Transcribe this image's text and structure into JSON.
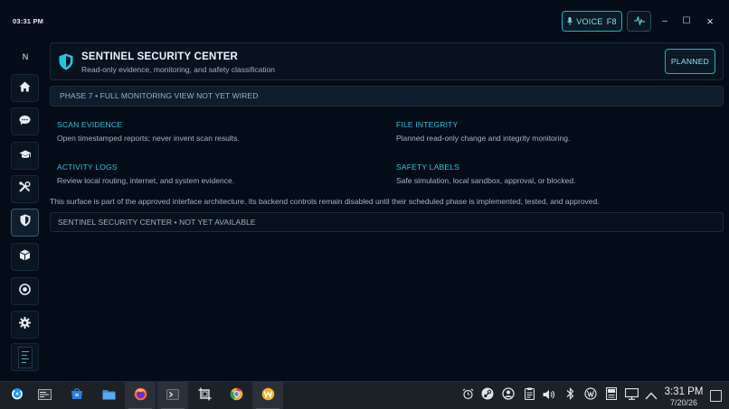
{
  "topbar": {
    "time": "03:31 PM",
    "voice_label": "VOICE",
    "voice_key": "F8",
    "minimize": "–",
    "maximize": "☐",
    "close": "×"
  },
  "rail": {
    "letter": "N",
    "items": [
      "home-icon",
      "chat-icon",
      "graduation-cap-icon",
      "tools-icon",
      "shield-icon",
      "box-icon",
      "target-icon",
      "gear-icon"
    ],
    "active": "shield-icon"
  },
  "header": {
    "title": "SENTINEL SECURITY CENTER",
    "subtitle": "Read-only evidence, monitoring, and safety classification",
    "badge": "PLANNED"
  },
  "phase": "PHASE 7 • FULL MONITORING VIEW NOT YET WIRED",
  "sections": [
    {
      "title": "SCAN EVIDENCE",
      "desc": "Open timestamped reports; never invent scan results."
    },
    {
      "title": "FILE INTEGRITY",
      "desc": "Planned read-only change and integrity monitoring."
    },
    {
      "title": "ACTIVITY LOGS",
      "desc": "Review local routing, internet, and system evidence."
    },
    {
      "title": "SAFETY LABELS",
      "desc": "Safe simulation, local sandbox, approval, or blocked."
    }
  ],
  "note": "This surface is part of the approved interface architecture. Its backend controls remain disabled until their scheduled phase is implemented, tested, and approved.",
  "status": "SENTINEL SECURITY CENTER • NOT YET AVAILABLE",
  "taskbar": {
    "apps": [
      "app-launcher-icon",
      "task-manager-icon",
      "discover-store-icon",
      "file-manager-icon",
      "firefox-icon",
      "terminal-icon",
      "screenshot-icon",
      "chrome-like-icon",
      "w-app-icon"
    ],
    "tray": [
      "alarm-icon",
      "steam-icon",
      "steam-user-icon",
      "clipboard-icon",
      "volume-icon",
      "bluetooth-icon",
      "vpn-icon",
      "notes-icon",
      "display-icon",
      "chevron-up-icon"
    ],
    "time": "3:31 PM",
    "date": "7/20/26"
  },
  "colors": {
    "accent": "#17b3c9",
    "section_title": "#2bc4dc",
    "background": "#040c18"
  }
}
